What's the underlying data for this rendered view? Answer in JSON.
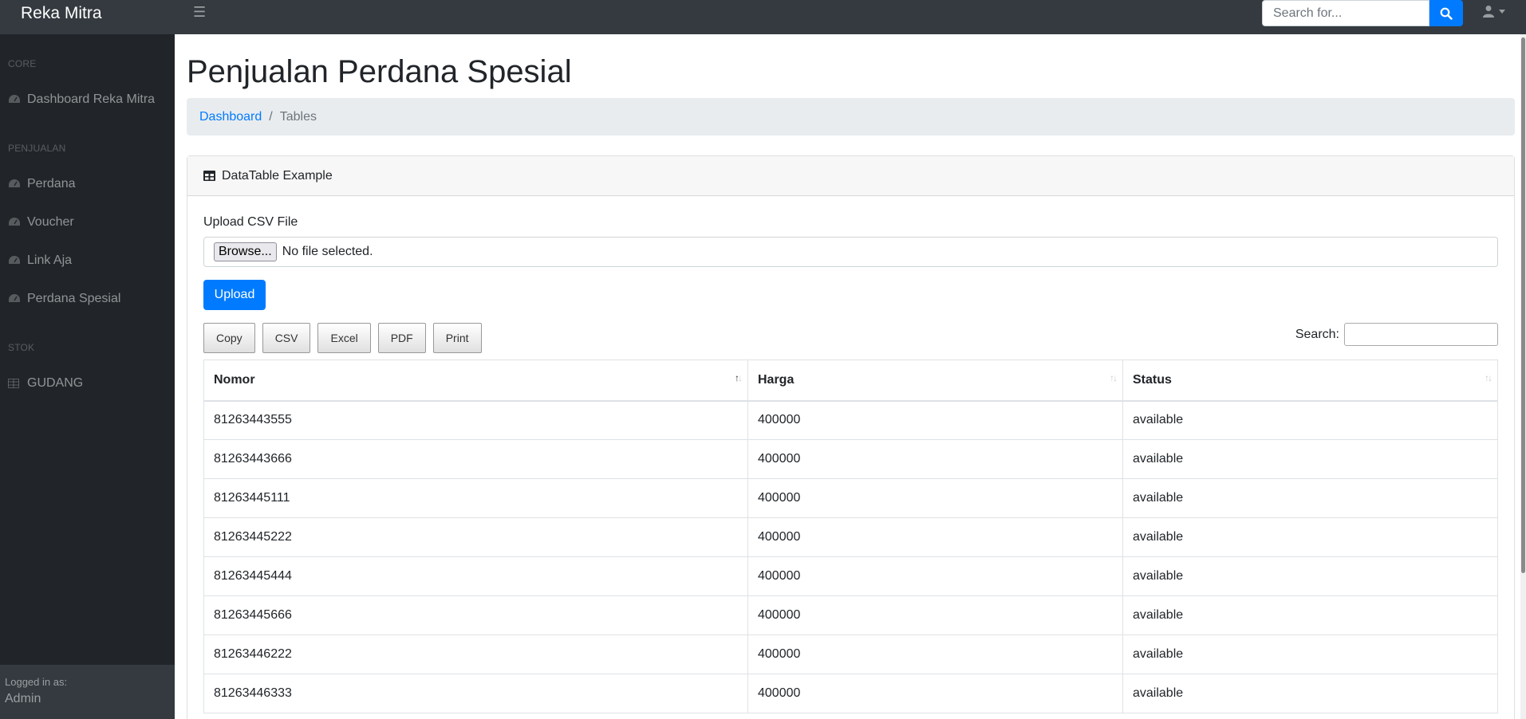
{
  "navbar": {
    "brand": "Reka Mitra",
    "search_placeholder": "Search for..."
  },
  "sidebar": {
    "headings": {
      "core": "CORE",
      "penjualan": "PENJUALAN",
      "stok": "STOK"
    },
    "items": [
      {
        "label": "Dashboard Reka Mitra",
        "icon": "tachometer-icon"
      },
      {
        "label": "Perdana",
        "icon": "tachometer-icon"
      },
      {
        "label": "Voucher",
        "icon": "tachometer-icon"
      },
      {
        "label": "Link Aja",
        "icon": "tachometer-icon"
      },
      {
        "label": "Perdana Spesial",
        "icon": "tachometer-icon"
      },
      {
        "label": "GUDANG",
        "icon": "table-icon"
      }
    ],
    "footer": {
      "logged_in_as": "Logged in as:",
      "user": "Admin"
    }
  },
  "page": {
    "title": "Penjualan Perdana Spesial",
    "breadcrumb": {
      "link": "Dashboard",
      "separator": "/",
      "active": "Tables"
    }
  },
  "card": {
    "header": "DataTable Example",
    "upload_label": "Upload CSV File",
    "browse_label": "Browse...",
    "file_status": "No file selected.",
    "upload_button": "Upload"
  },
  "datatable": {
    "buttons": [
      "Copy",
      "CSV",
      "Excel",
      "PDF",
      "Print"
    ],
    "search_label": "Search:",
    "columns": [
      "Nomor",
      "Harga",
      "Status"
    ],
    "rows": [
      [
        "81263443555",
        "400000",
        "available"
      ],
      [
        "81263443666",
        "400000",
        "available"
      ],
      [
        "81263445111",
        "400000",
        "available"
      ],
      [
        "81263445222",
        "400000",
        "available"
      ],
      [
        "81263445444",
        "400000",
        "available"
      ],
      [
        "81263445666",
        "400000",
        "available"
      ],
      [
        "81263446222",
        "400000",
        "available"
      ],
      [
        "81263446333",
        "400000",
        "available"
      ]
    ]
  },
  "colors": {
    "primary": "#007bff",
    "navbar": "#343a40",
    "sidebar": "#212529"
  }
}
